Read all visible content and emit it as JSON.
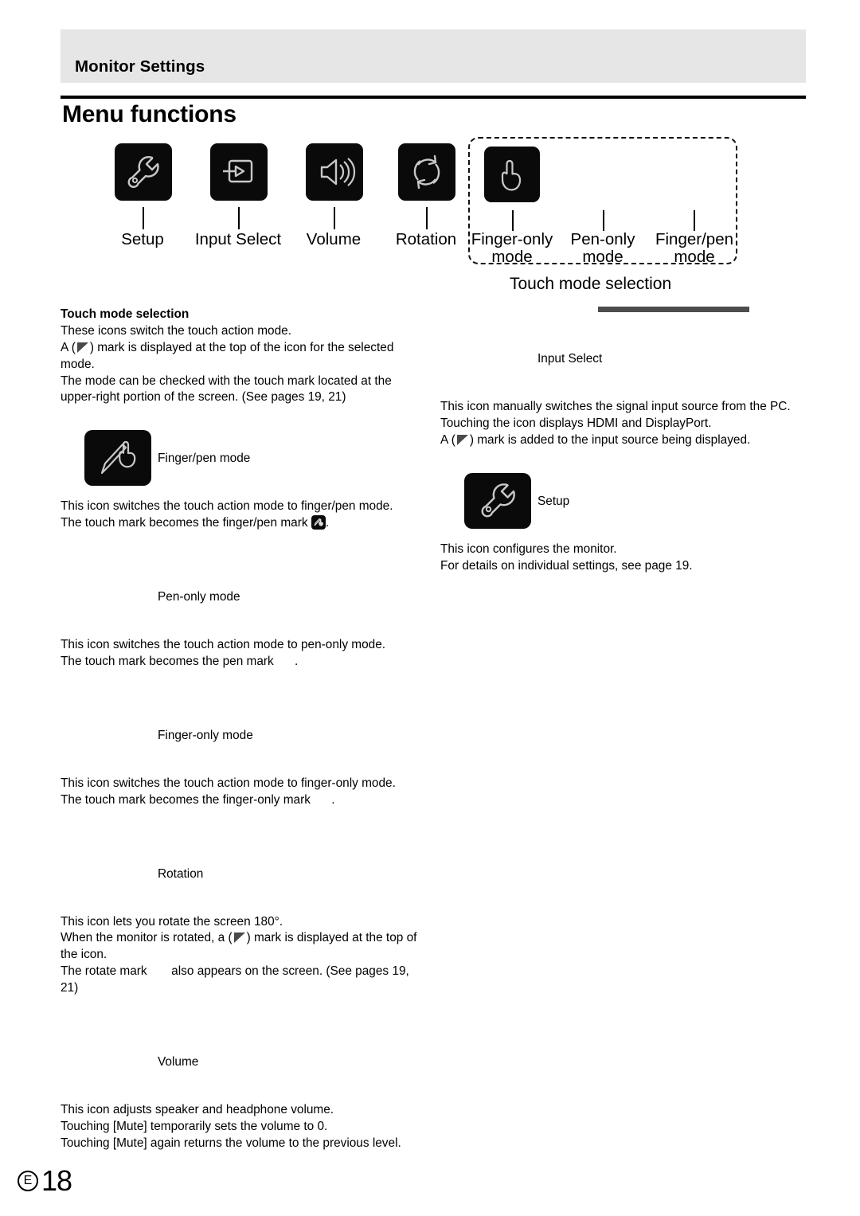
{
  "header": {
    "title": "Monitor Settings"
  },
  "page_title": "Menu functions",
  "diagram": {
    "items": [
      {
        "label": "Setup",
        "icon": "wrench-icon"
      },
      {
        "label": "Input Select",
        "icon": "input-source-icon"
      },
      {
        "label": "Volume",
        "icon": "speaker-icon"
      },
      {
        "label": "Rotation",
        "icon": "rotate-icon"
      },
      {
        "label_line1": "Finger-only",
        "label_line2": "mode",
        "icon": "finger-icon"
      },
      {
        "label_line1": "Pen-only",
        "label_line2": "mode",
        "icon": "pen-icon"
      },
      {
        "label_line1": "Finger/pen",
        "label_line2": "mode",
        "icon": "finger-pen-icon"
      }
    ],
    "group_caption": "Touch mode selection"
  },
  "left_column": {
    "touch_mode_selection": {
      "heading": "Touch mode selection",
      "line1": "These icons switch the touch action mode.",
      "line2_a": "A (",
      "line2_b": ") mark is displayed at the top of the icon for the selected mode.",
      "line3": "The mode can be checked with the touch mark located at the upper-right portion of the screen. (See pages 19, 21)"
    },
    "finger_pen": {
      "caption": "Finger/pen mode",
      "line1": "This icon switches the touch action mode to finger/pen mode.",
      "line2_a": "The touch mark becomes the finger/pen mark ",
      "line2_b": "."
    },
    "pen_only": {
      "caption": "Pen-only mode",
      "line1": "This icon switches the touch action mode to pen-only mode.",
      "line2_a": "The touch mark becomes the pen mark ",
      "line2_b": "."
    },
    "finger_only": {
      "caption": "Finger-only mode",
      "line1": "This icon switches the touch action mode to finger-only mode.",
      "line2_a": "The touch mark becomes the finger-only mark ",
      "line2_b": "."
    },
    "rotation": {
      "caption": "Rotation",
      "line1": "This icon lets you rotate the screen 180°.",
      "line2_a": "When the monitor is rotated, a (",
      "line2_b": ") mark is displayed at the top of the icon.",
      "line3_a": "The rotate mark ",
      "line3_b": " also appears on the screen. (See pages 19, 21)"
    },
    "volume": {
      "caption": "Volume",
      "line1": "This icon adjusts speaker and headphone volume.",
      "line2": "Touching [Mute] temporarily sets the volume to 0.",
      "line3": "Touching [Mute] again returns the volume to the previous level."
    }
  },
  "right_column": {
    "input_select": {
      "caption": "Input Select",
      "line1": "This icon manually switches the signal input source from the PC.",
      "line2": "Touching the icon displays HDMI and DisplayPort.",
      "line3_a": "A (",
      "line3_b": ") mark is added to the input source being displayed."
    },
    "setup": {
      "caption": "Setup",
      "line1": "This icon configures the monitor.",
      "line2": "For details on individual settings, see page 19."
    }
  },
  "footer": {
    "region": "E",
    "page_number": "18"
  },
  "colors": {
    "header_band": "#e6e6e6",
    "icon_tile": "#0a0a0a",
    "icon_stroke": "#c8c8c8",
    "bar": "#4d4d4d"
  }
}
